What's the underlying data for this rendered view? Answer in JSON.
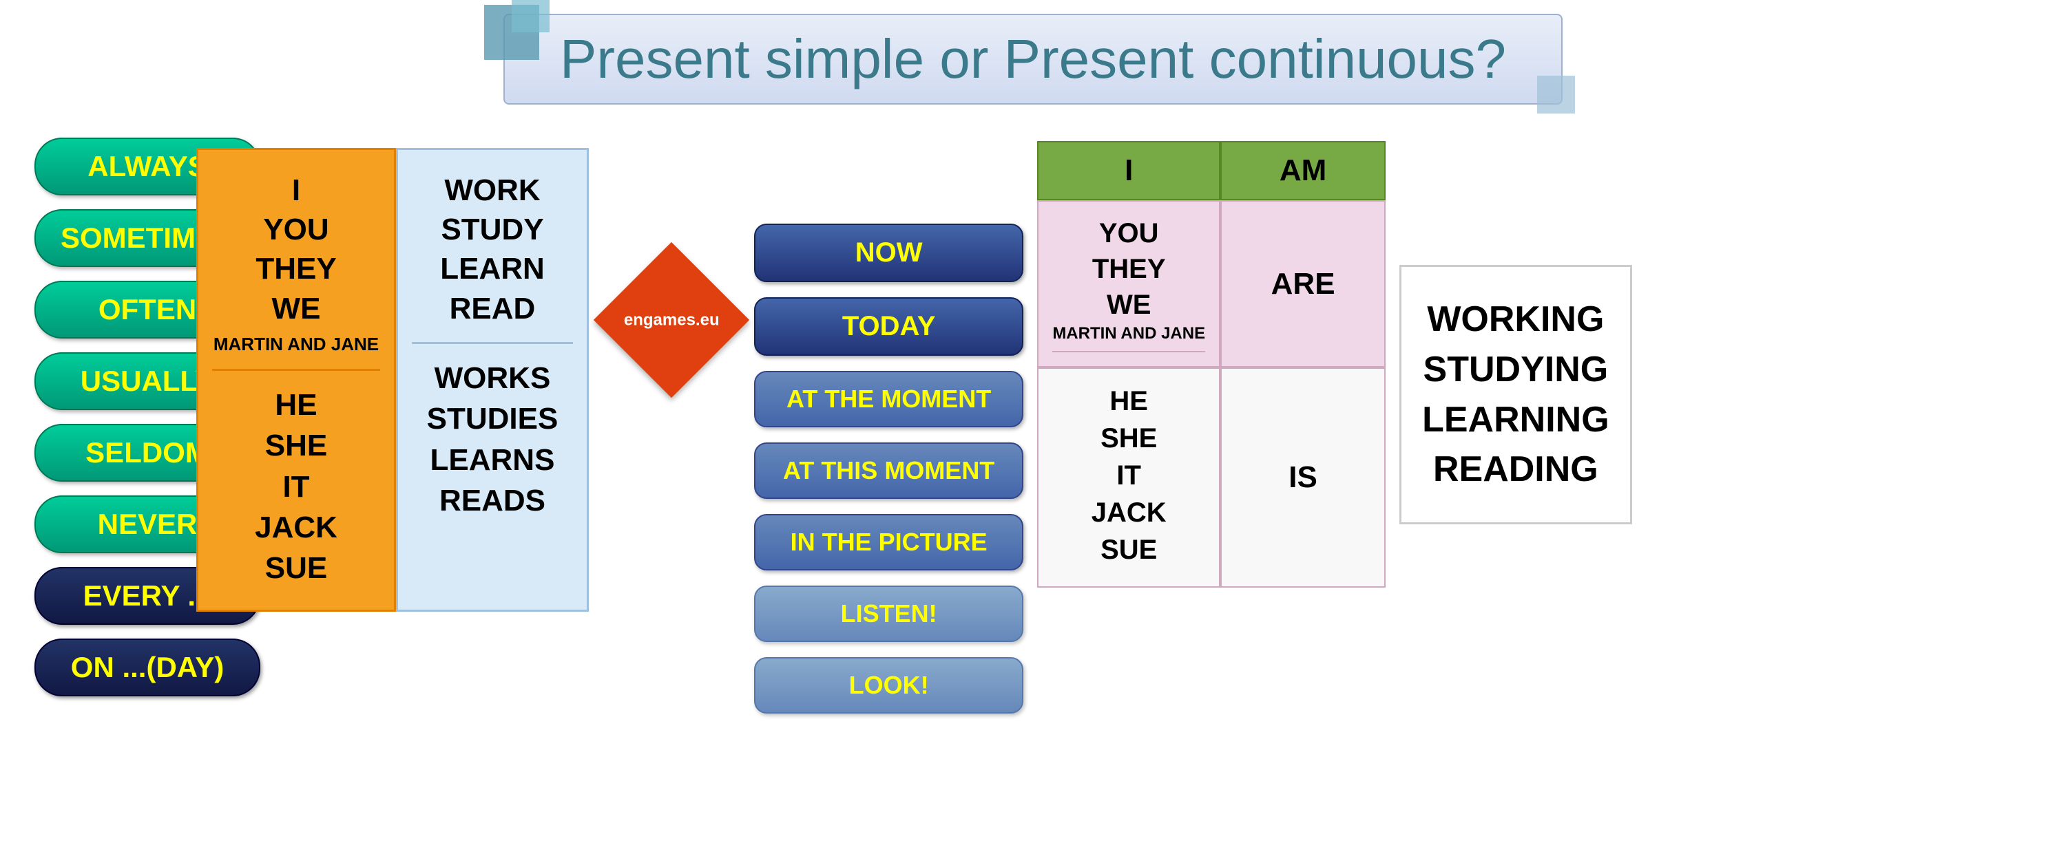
{
  "title": "Present simple or Present continuous?",
  "left_sidebar": {
    "green_pills": [
      "ALWAYS",
      "SOMETIMES",
      "OFTEN",
      "USUALLY",
      "SELDOM",
      "NEVER"
    ],
    "dark_pills": [
      "EVERY ...",
      "ON ...(DAY)"
    ]
  },
  "simple_section": {
    "subjects_top": [
      "I",
      "YOU",
      "THEY",
      "WE"
    ],
    "subjects_small": "MARTIN AND JANE",
    "subjects_bottom": [
      "HE",
      "SHE",
      "IT",
      "JACK",
      "SUE"
    ],
    "verbs_top": [
      "WORK",
      "STUDY",
      "LEARN",
      "READ"
    ],
    "verbs_bottom": [
      "WORKS",
      "STUDIES",
      "LEARNS",
      "READS"
    ]
  },
  "diamond": {
    "text": "engames.eu"
  },
  "time_expressions": {
    "buttons": [
      "NOW",
      "TODAY",
      "AT THE MOMENT",
      "AT THIS MOMENT",
      "IN THE PICTURE",
      "LISTEN!",
      "LOOK!"
    ]
  },
  "continuous_section": {
    "col1_header": "I",
    "col1_top_subjects": [
      "YOU",
      "THEY",
      "WE"
    ],
    "col1_top_small": "MARTIN AND JANE",
    "col1_bottom_subjects": [
      "HE",
      "SHE",
      "IT",
      "JACK",
      "SUE"
    ],
    "col2_header": "AM",
    "col2_top_verb": "ARE",
    "col2_bottom_verb": "IS"
  },
  "right_section": {
    "verbs": [
      "WORKING",
      "STUDYING",
      "LEARNING",
      "READING"
    ]
  }
}
